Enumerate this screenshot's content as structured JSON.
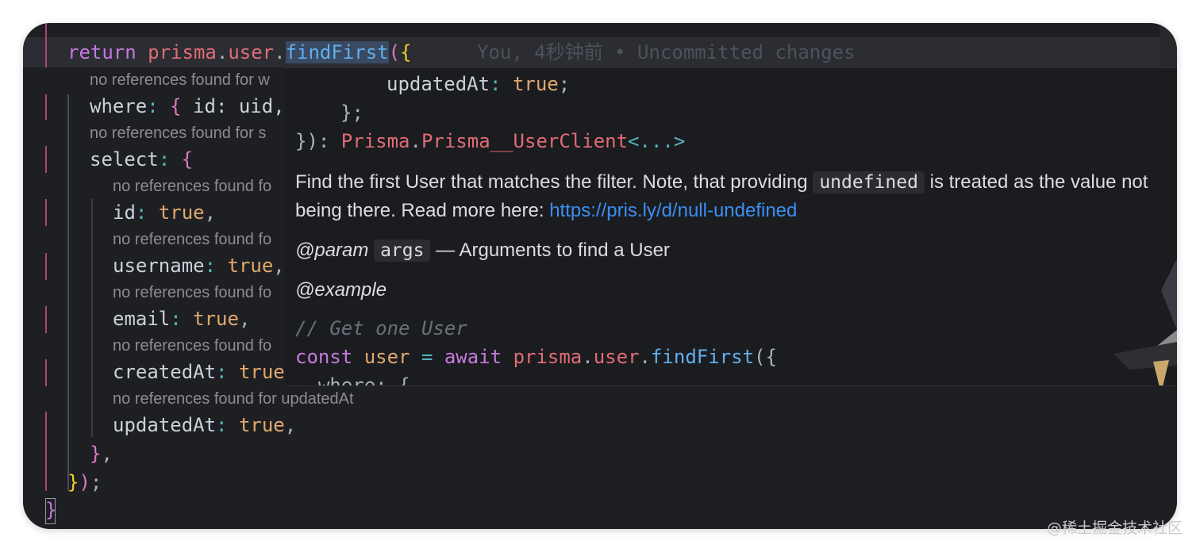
{
  "editor": {
    "line_return": {
      "kw": "return",
      "obj": "prisma",
      "dot1": ".",
      "prop": "user",
      "dot2": ".",
      "fn": "findFirst",
      "paren": "(",
      "brace": "{"
    },
    "blame": "You, 4秒钟前 • Uncommitted changes",
    "hints": {
      "where": "no references found for w",
      "select": "no references found for s",
      "id": "no references found fo",
      "username": "no references found fo",
      "email": "no references found fo",
      "createdAt": "no references found fo",
      "updatedAt": "no references found for updatedAt"
    },
    "line_where": {
      "key": "where",
      "colon": ": ",
      "brace": "{ ",
      "rest": "id: uid,"
    },
    "line_select": {
      "key": "select",
      "colon": ": ",
      "brace": "{"
    },
    "line_id": {
      "key": "id",
      "colon": ": ",
      "val": "true",
      "comma": ","
    },
    "line_username": {
      "key": "username",
      "colon": ": ",
      "val": "true",
      "comma": ","
    },
    "line_email": {
      "key": "email",
      "colon": ": ",
      "val": "true",
      "comma": ","
    },
    "line_createdAt": {
      "key": "createdAt",
      "colon": ": ",
      "val": "true"
    },
    "line_updatedAt": {
      "key": "updatedAt",
      "colon": ": ",
      "val": "true",
      "comma": ","
    },
    "line_close1": {
      "brace": "}",
      "comma": ","
    },
    "line_close2": {
      "brace": "}",
      "paren": ")",
      "semi": ";"
    },
    "line_close3": {
      "brace": "}"
    }
  },
  "popup": {
    "sig_updated": {
      "key": "updatedAt",
      "colon": ": ",
      "val": "true",
      "semi": ";"
    },
    "sig_close": "};",
    "sig_return": {
      "prefix": "}): ",
      "ns": "Prisma",
      "dot": ".",
      "type": "Prisma__UserClient",
      "generic": "<...>"
    },
    "doc1_a": "Find the first User that matches the filter. Note, that providing ",
    "doc1_code": "undefined",
    "doc1_b": " is treated as the value not",
    "doc2_a": "being there. Read more here: ",
    "doc2_link": "https://pris.ly/d/null-undefined",
    "param_tag": "@param",
    "param_name": "args",
    "param_desc": " — Arguments to find a User",
    "example_tag": "@example",
    "ex_comment": "// Get one User",
    "ex_line": {
      "kw": "const",
      "var": "user",
      "eq": " = ",
      "await": "await",
      "obj": "prisma",
      "dot1": ".",
      "prop": "user",
      "dot2": ".",
      "fn": "findFirst",
      "rest": "({"
    },
    "ex_partial": "  where: {"
  },
  "watermark": "@稀土掘金技术社区",
  "colors": {
    "background": "#1e1f22",
    "popup": "#1b1c1f",
    "link": "#3b8ef3",
    "keyword": "#c678dd"
  }
}
